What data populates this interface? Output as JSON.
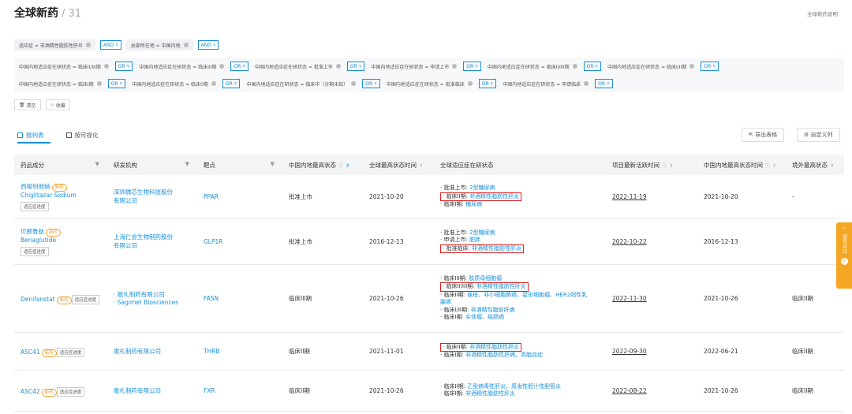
{
  "header": {
    "title": "全球新药",
    "count": "/ 31",
    "help": "全球新药说明"
  },
  "row1": {
    "chip1": "适应症 = 非酒精性脂肪性肝炎",
    "op1": "AND",
    "chip2": "总部所在地 = 中国内地",
    "op2": "AND"
  },
  "status_filters_line1": [
    "中国内地适应症在研状态 = 临床II/III期",
    "中国内地适应症在研状态 = 临床III期",
    "中国内地适应症在研状态 = 批准上市",
    "中国内地适应症在研状态 = 申请上市",
    "中国内地适应症在研状态 = 临床II/III期",
    "中国内地适应症在研状态 = 临床I/II期"
  ],
  "status_filters_line2": [
    "中国内地适应症在研状态 = 临床I期",
    "中国内地适应症在研状态 = 临床0期",
    "中国内地适应症在研状态 = 临床中（分期未知）",
    "中国内地适应症在研状态 = 批准临床",
    "中国内地适应症在研状态 = 申请临床"
  ],
  "or_label": "OR",
  "actions": {
    "clear": "清空",
    "save": "收藏"
  },
  "tabs": {
    "list": "按列表",
    "visual": "按可视化"
  },
  "toolbar": {
    "export": "导出表格",
    "custom": "自定义列"
  },
  "columns": {
    "drug": "药品成分",
    "org": "研发机构",
    "target": "靶点",
    "cn_status": "中国内地最高状态",
    "global_time": "全球最高状态时间",
    "global_ind": "全球适应症在研状态",
    "active_time": "项目最新活跃时间",
    "cn_time": "中国内地最高状态时间",
    "overseas": "境外最高状态"
  },
  "new_tag": "新药",
  "progress_btn": "适应症进度",
  "rows": [
    {
      "cn": "西格列他钠",
      "en": "Chiglitazar Sodium",
      "org1": "深圳微芯生物科技股份",
      "org2": "有限公司",
      "org3": "",
      "target": "PPAR",
      "cn_status": "批准上市",
      "global_time": "2021-10-20",
      "ind": [
        {
          "stage": "· 批准上市:",
          "disease": "2型糖尿病",
          "boxed": false
        },
        {
          "stage": "· 临床II期:",
          "disease": "非酒精性脂肪性肝炎",
          "boxed": true
        },
        {
          "stage": "· 临床I期:",
          "disease": "糖尿病",
          "boxed": false
        }
      ],
      "active_time": "2022-11-19",
      "cn_time": "2021-10-20",
      "overseas": "-"
    },
    {
      "cn": "贝那鲁肽",
      "en": "Benaglutide",
      "org1": "上海仁会生物制药股份",
      "org2": "有限公司",
      "org3": "",
      "target": "GLP1R",
      "cn_status": "批准上市",
      "global_time": "2016-12-13",
      "ind": [
        {
          "stage": "· 批准上市:",
          "disease": "2型糖尿病",
          "boxed": false
        },
        {
          "stage": "· 申请上市:",
          "disease": "肥胖",
          "boxed": false
        },
        {
          "stage": "· 批准临床:",
          "disease": "非酒精性脂肪性肝炎",
          "boxed": true
        }
      ],
      "active_time": "2022-10-22",
      "cn_time": "2016-12-13",
      "overseas": ""
    },
    {
      "cn": "Denifanstat",
      "en": "",
      "org1": "· 歌礼制药有限公司",
      "org2": "· Sagimet Biosciences",
      "org3": "",
      "target": "FASN",
      "cn_status": "临床III期",
      "global_time": "2021-10-26",
      "ind": [
        {
          "stage": "· 临床III期:",
          "disease": "胶质母细胞瘤",
          "boxed": false
        },
        {
          "stage": "· 临床II/III期:",
          "disease": "非酒精性脂肪性肝炎",
          "boxed": true
        },
        {
          "stage": "· 临床II期:",
          "disease": "痤疮、非小细胞肺癌、星形细胞瘤、HER2阳性乳",
          "boxed": false
        },
        {
          "stage": "",
          "disease": "腺癌",
          "boxed": false
        },
        {
          "stage": "· 临床I/II期:",
          "disease": "非酒精性脂肪肝病",
          "boxed": false
        },
        {
          "stage": "· 临床I期:",
          "disease": "实体瘤、结肠癌",
          "boxed": false
        }
      ],
      "active_time": "2022-11-30",
      "cn_time": "2021-10-26",
      "overseas": "临床II期"
    },
    {
      "cn": "ASC41",
      "en": "",
      "org1": "歌礼制药有限公司",
      "org2": "",
      "org3": "",
      "target": "THRB",
      "cn_status": "临床II期",
      "global_time": "2021-11-01",
      "ind": [
        {
          "stage": "· 临床II期:",
          "disease": "非酒精性脂肪性肝炎",
          "boxed": true
        },
        {
          "stage": "· 临床I期:",
          "disease": "非酒精性脂肪性肝病、高脂血症",
          "boxed": false
        }
      ],
      "active_time": "2022-09-30",
      "cn_time": "2022-06-21",
      "overseas": "临床II期"
    },
    {
      "cn": "ASC42",
      "en": "",
      "org1": "歌礼制药有限公司",
      "org2": "",
      "org3": "",
      "target": "FXR",
      "cn_status": "临床II期",
      "global_time": "2021-10-26",
      "ind": [
        {
          "stage": "· 临床II期:",
          "disease": "乙型病毒性肝炎、原发性胆汁性胆管炎",
          "boxed": false
        },
        {
          "stage": "· 临床I期:",
          "disease": "非酒精性脂肪性肝炎",
          "boxed": false
        }
      ],
      "active_time": "2022-08-22",
      "cn_time": "2021-10-26",
      "overseas": "临床II期"
    }
  ],
  "side_tab": {
    "arrow": "«",
    "label": "项目对比",
    "badge": "0"
  }
}
